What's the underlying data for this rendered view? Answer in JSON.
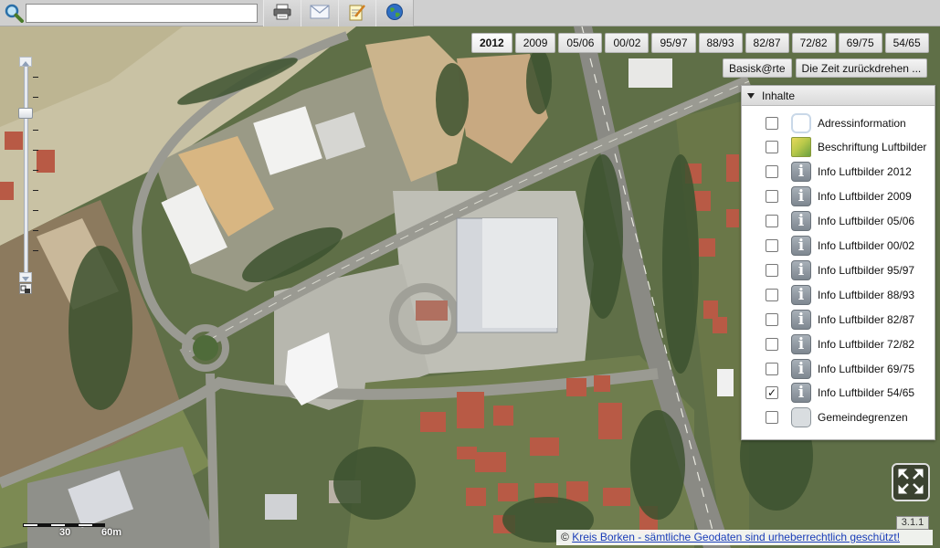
{
  "toolbar": {
    "search_placeholder": "",
    "search_value": "",
    "print_icon": "printer-icon",
    "mail_icon": "envelope-icon",
    "note_icon": "notepad-icon",
    "globe_icon": "globe-icon"
  },
  "years": [
    "2012",
    "2009",
    "05/06",
    "00/02",
    "95/97",
    "88/93",
    "82/87",
    "72/82",
    "69/75",
    "54/65"
  ],
  "active_year": "2012",
  "basis_buttons": [
    "Basisk@rte",
    "Die Zeit zurückdrehen ..."
  ],
  "layers_panel": {
    "title": "Inhalte",
    "items": [
      {
        "label": "Adressinformation",
        "icon": "address-icon",
        "checked": false
      },
      {
        "label": "Beschriftung Luftbilder",
        "icon": "label-map-icon",
        "checked": false
      },
      {
        "label": "Info Luftbilder 2012",
        "icon": "info-icon",
        "checked": false
      },
      {
        "label": "Info Luftbilder 2009",
        "icon": "info-icon",
        "checked": false
      },
      {
        "label": "Info Luftbilder 05/06",
        "icon": "info-icon",
        "checked": false
      },
      {
        "label": "Info Luftbilder 00/02",
        "icon": "info-icon",
        "checked": false
      },
      {
        "label": "Info Luftbilder 95/97",
        "icon": "info-icon",
        "checked": false
      },
      {
        "label": "Info Luftbilder 88/93",
        "icon": "info-icon",
        "checked": false
      },
      {
        "label": "Info Luftbilder 82/87",
        "icon": "info-icon",
        "checked": false
      },
      {
        "label": "Info Luftbilder 72/82",
        "icon": "info-icon",
        "checked": false
      },
      {
        "label": "Info Luftbilder 69/75",
        "icon": "info-icon",
        "checked": false
      },
      {
        "label": "Info Luftbilder 54/65",
        "icon": "info-icon",
        "checked": true
      },
      {
        "label": "Gemeindegrenzen",
        "icon": "boundary-icon",
        "checked": false
      }
    ]
  },
  "scale": {
    "label_mid": "30",
    "label_end": "60m"
  },
  "version": "3.1.1",
  "copyright": {
    "prefix": "©",
    "link_text": "Kreis Borken - sämtliche Geodaten sind urheberrechtlich geschützt!"
  },
  "colors": {
    "toolbar": "#cfcfcf",
    "panel_bg": "#ffffff",
    "link": "#1a3db8"
  }
}
